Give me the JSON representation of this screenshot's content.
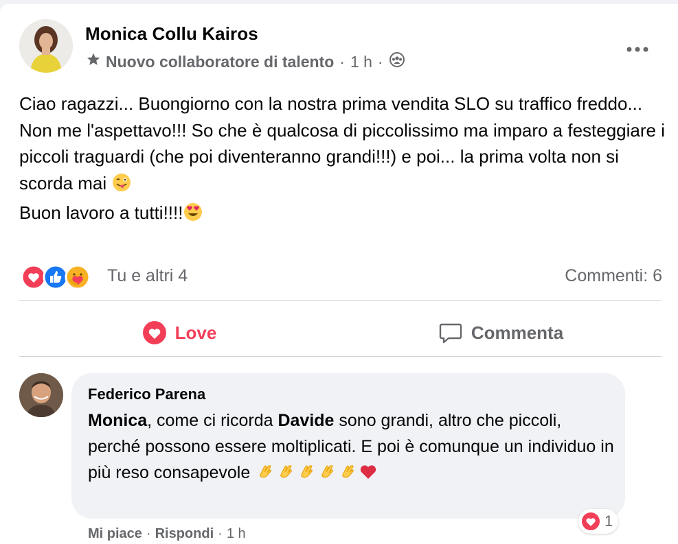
{
  "post": {
    "author": "Monica Collu Kairos",
    "badge_icon": "star-badge-icon",
    "badge": "Nuovo collaboratore di talento",
    "separator": "·",
    "time": "1 h",
    "audience_icon": "group-audience-icon",
    "text_lines": [
      "Ciao ragazzi... Buongiorno con la nostra prima vendita SLO su traffico freddo...",
      "Non me l'aspettavo!!! So che è qualcosa di piccolissimo ma imparo a festeggiare i piccoli traguardi (che poi diventeranno grandi!!!) e poi... la prima volta non si scorda mai",
      "Buon lavoro a tutti!!!!"
    ]
  },
  "reactions": {
    "types": [
      "love",
      "like",
      "care"
    ],
    "summary": "Tu e altri 4",
    "comments": "Commenti: 6"
  },
  "actions": {
    "love": "Love",
    "comment": "Commenta"
  },
  "comment": {
    "author": "Federico Parena",
    "mention_1": "Monica",
    "text_1": ", come ci ricorda ",
    "mention_2": "Davide",
    "text_2": " sono grandi, altro che piccoli, perché possono essere moltiplicati. E poi è comunque un individuo in più reso consapevole ",
    "reaction_count": "1",
    "like_action": "Mi piace",
    "reply_action": "Rispondi",
    "time": "1 h"
  },
  "colors": {
    "love": "#f33e58",
    "like": "#1877f2",
    "secondary_text": "#65676b",
    "bubble": "#f0f2f5"
  }
}
